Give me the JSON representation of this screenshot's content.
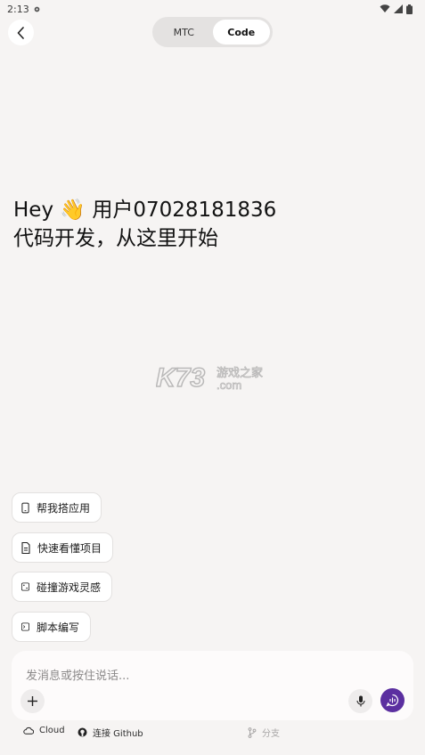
{
  "status_bar": {
    "time": "2:13"
  },
  "header": {
    "tabs": [
      {
        "label": "MTC"
      },
      {
        "label": "Code"
      }
    ],
    "active_tab": "Code"
  },
  "greeting": {
    "line1": "Hey 👋  用户07028181836",
    "line2": "代码开发，从这里开始"
  },
  "watermark": {
    "logo_text": "K73",
    "site_text": "游戏之家",
    "domain": ".com"
  },
  "suggestions": [
    {
      "label": "帮我搭应用",
      "icon": "phone-icon"
    },
    {
      "label": "快速看懂项目",
      "icon": "document-icon"
    },
    {
      "label": "碰撞游戏灵感",
      "icon": "dice-icon"
    },
    {
      "label": "脚本编写",
      "icon": "terminal-icon"
    }
  ],
  "composer": {
    "placeholder": "发消息或按住说话..."
  },
  "bottom_bar": {
    "cloud_label": "Cloud",
    "github_label": "连接 Github",
    "branch_label": "分支"
  },
  "colors": {
    "accent": "#5b2fa0",
    "background": "#f6f4f3"
  }
}
